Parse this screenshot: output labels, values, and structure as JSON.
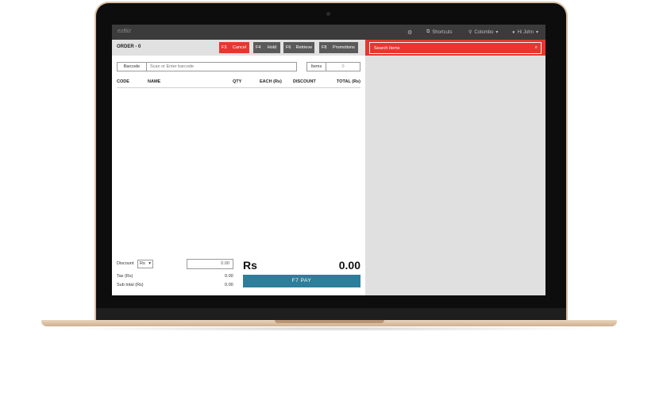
{
  "app": {
    "brand": "ezBiz",
    "nav": {
      "settings_icon": "gear-icon",
      "shortcuts_label": "Shortcuts",
      "location_label": "Colombo",
      "user_label": "Hi John"
    }
  },
  "order": {
    "title": "ORDER - 0",
    "buttons": [
      {
        "key": "F3",
        "label": "Cancel",
        "color": "#e8362f"
      },
      {
        "key": "F4",
        "label": "Hold",
        "color": "#5a5a5a"
      },
      {
        "key": "F6",
        "label": "Retrieve",
        "color": "#5a5a5a"
      },
      {
        "key": "F8",
        "label": "Promotions",
        "color": "#5a5a5a"
      }
    ],
    "barcode_label": "Barcode",
    "barcode_placeholder": "Scan or Enter barcode",
    "items_label": "Items",
    "items_value": "0",
    "columns": [
      "CODE",
      "NAME",
      "QTY",
      "EACH (Rs)",
      "DISCOUNT",
      "TOTAL (Rs)"
    ]
  },
  "totals": {
    "discount_label": "Discount",
    "discount_unit": "Rs",
    "discount_value": "0.00",
    "tax_label": "Tax (Rs)",
    "tax_value": "0.00",
    "subtotal_label": "Sub total (Rs)",
    "subtotal_value": "0.00",
    "currency": "Rs",
    "grand_total": "0.00",
    "pay_label": "F7 PAY"
  },
  "search": {
    "placeholder": "Search Items"
  },
  "colors": {
    "accent": "#e8362f",
    "pay": "#2d7e9b",
    "topbar": "#3b3b3b"
  }
}
